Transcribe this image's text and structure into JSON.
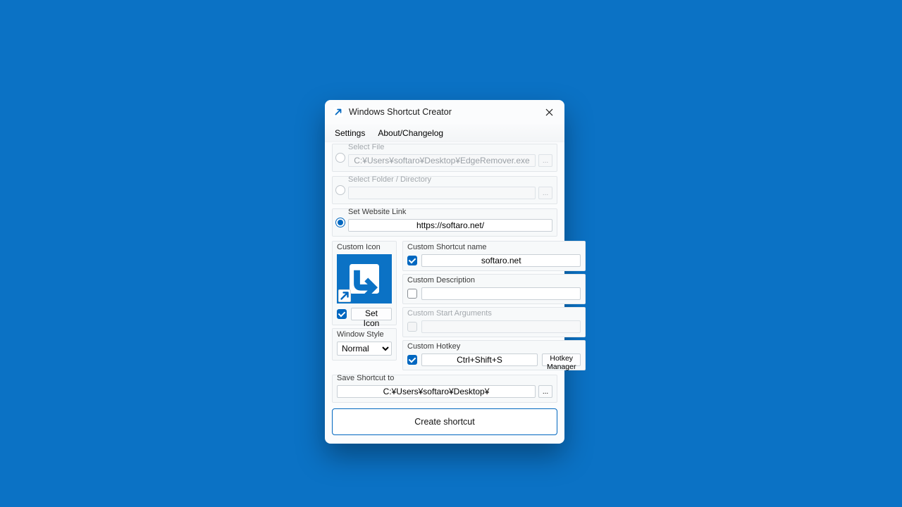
{
  "title": "Windows Shortcut Creator",
  "menu": {
    "settings": "Settings",
    "about": "About/Changelog"
  },
  "selectFile": {
    "label": "Select File",
    "value": "C:¥Users¥softaro¥Desktop¥EdgeRemover.exe",
    "browse": "..."
  },
  "selectFolder": {
    "label": "Select Folder / Directory",
    "value": "",
    "browse": "..."
  },
  "website": {
    "label": "Set Website Link",
    "value": "https://softaro.net/"
  },
  "customIcon": {
    "label": "Custom Icon",
    "setIconLabel": "Set Icon"
  },
  "shortcutName": {
    "label": "Custom Shortcut name",
    "value": "softaro.net"
  },
  "description": {
    "label": "Custom Description",
    "value": ""
  },
  "startArgs": {
    "label": "Custom Start Arguments",
    "value": ""
  },
  "windowStyle": {
    "label": "Window Style",
    "value": "Normal"
  },
  "hotkey": {
    "label": "Custom Hotkey",
    "value": "Ctrl+Shift+S",
    "manager": "Hotkey Manager"
  },
  "saveTo": {
    "label": "Save Shortcut to",
    "value": "C:¥Users¥softaro¥Desktop¥",
    "browse": "..."
  },
  "createButton": "Create shortcut"
}
